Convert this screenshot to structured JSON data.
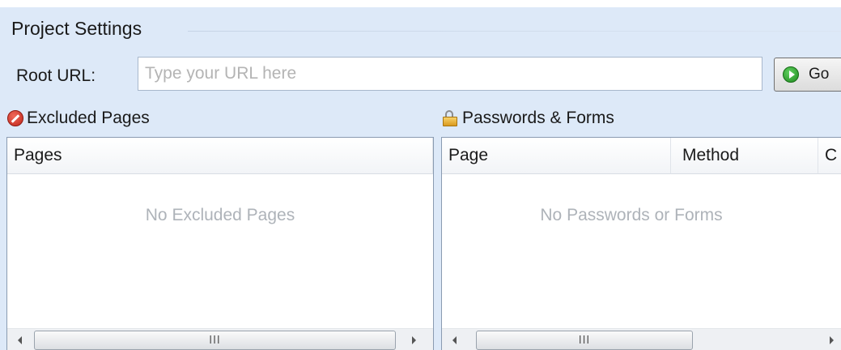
{
  "project": {
    "title": "Project Settings",
    "root_url_label": "Root URL:",
    "root_url_value": "",
    "root_url_placeholder": "Type your URL here",
    "go_label": "Go"
  },
  "excluded": {
    "title": "Excluded Pages",
    "columns": [
      "Pages"
    ],
    "rows": [],
    "empty_text": "No Excluded Pages"
  },
  "passwords": {
    "title": "Passwords & Forms",
    "columns": [
      "Page",
      "Method",
      "C"
    ],
    "rows": [],
    "empty_text": "No Passwords or Forms"
  },
  "scrollbar_grip": "III",
  "icons": {
    "go": "play-circle-icon",
    "excluded": "no-entry-icon",
    "passwords": "padlock-icon"
  },
  "colors": {
    "background": "#dde9f8",
    "placeholder": "#b4b4b4",
    "empty_text": "#aeb3b9",
    "go_icon": "#2a9a2a",
    "excluded_icon": "#d0301f",
    "lock_icon": "#e8b33a"
  }
}
